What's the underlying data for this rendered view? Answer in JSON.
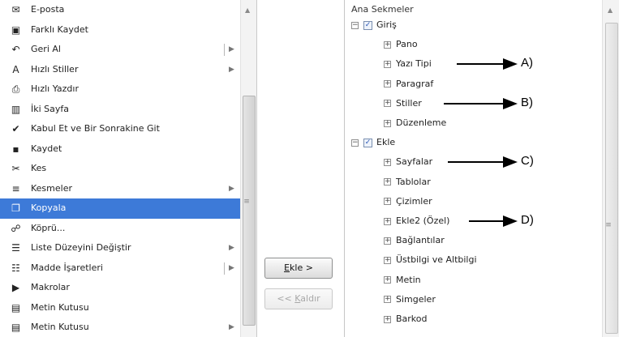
{
  "commands": [
    {
      "label": "E-posta",
      "icon": "email-icon",
      "glyph": "✉"
    },
    {
      "label": "Farklı Kaydet",
      "icon": "save-as-icon",
      "glyph": "▣"
    },
    {
      "label": "Geri Al",
      "icon": "undo-icon",
      "glyph": "↶",
      "submenu": true,
      "split": true
    },
    {
      "label": "Hızlı Stiller",
      "icon": "quick-styles-icon",
      "glyph": "A",
      "submenu": true
    },
    {
      "label": "Hızlı Yazdır",
      "icon": "quick-print-icon",
      "glyph": "⎙"
    },
    {
      "label": "İki Sayfa",
      "icon": "two-pages-icon",
      "glyph": "▥"
    },
    {
      "label": "Kabul Et ve Bir Sonrakine Git",
      "icon": "accept-next-icon",
      "glyph": "✔"
    },
    {
      "label": "Kaydet",
      "icon": "save-icon",
      "glyph": "▪"
    },
    {
      "label": "Kes",
      "icon": "cut-icon",
      "glyph": "✂"
    },
    {
      "label": "Kesmeler",
      "icon": "breaks-icon",
      "glyph": "≡",
      "submenu": true
    },
    {
      "label": "Kopyala",
      "icon": "copy-icon",
      "glyph": "❐",
      "selected": true
    },
    {
      "label": "Köprü...",
      "icon": "hyperlink-icon",
      "glyph": "☍"
    },
    {
      "label": "Liste Düzeyini Değiştir",
      "icon": "list-level-icon",
      "glyph": "☰",
      "submenu": true
    },
    {
      "label": "Madde İşaretleri",
      "icon": "bullets-icon",
      "glyph": "☷",
      "submenu": true,
      "split": true
    },
    {
      "label": "Makrolar",
      "icon": "macros-icon",
      "glyph": "▶"
    },
    {
      "label": "Metin Kutusu",
      "icon": "text-box-icon",
      "glyph": "▤"
    },
    {
      "label": "Metin Kutusu",
      "icon": "text-box-icon",
      "glyph": "▤",
      "submenu": true
    }
  ],
  "buttons": {
    "add_prefix": "E",
    "add_rest": "kle >",
    "remove_prefix": "<< ",
    "remove_key": "K",
    "remove_rest": "aldır"
  },
  "tree": {
    "header": "Ana Sekmeler",
    "nodes": [
      {
        "label": "Giriş",
        "level": 0,
        "expander": "−",
        "checked": true
      },
      {
        "label": "Pano",
        "level": 1,
        "expander": "+"
      },
      {
        "label": "Yazı Tipi",
        "level": 1,
        "expander": "+"
      },
      {
        "label": "Paragraf",
        "level": 1,
        "expander": "+"
      },
      {
        "label": "Stiller",
        "level": 1,
        "expander": "+"
      },
      {
        "label": "Düzenleme",
        "level": 1,
        "expander": "+"
      },
      {
        "label": "Ekle",
        "level": 0,
        "expander": "−",
        "checked": true
      },
      {
        "label": "Sayfalar",
        "level": 1,
        "expander": "+"
      },
      {
        "label": "Tablolar",
        "level": 1,
        "expander": "+"
      },
      {
        "label": "Çizimler",
        "level": 1,
        "expander": "+"
      },
      {
        "label": "Ekle2 (Özel)",
        "level": 1,
        "expander": "+"
      },
      {
        "label": "Bağlantılar",
        "level": 1,
        "expander": "+"
      },
      {
        "label": "Üstbilgi ve Altbilgi",
        "level": 1,
        "expander": "+"
      },
      {
        "label": "Metin",
        "level": 1,
        "expander": "+"
      },
      {
        "label": "Simgeler",
        "level": 1,
        "expander": "+"
      },
      {
        "label": "Barkod",
        "level": 1,
        "expander": "+"
      }
    ]
  },
  "annotations": [
    {
      "label": "A)",
      "target": "Yazı Tipi"
    },
    {
      "label": "B)",
      "target": "Stiller"
    },
    {
      "label": "C)",
      "target": "Sayfalar"
    },
    {
      "label": "D)",
      "target": "Ekle2 (Özel)"
    }
  ],
  "colors": {
    "selection": "#3d7ad8"
  }
}
